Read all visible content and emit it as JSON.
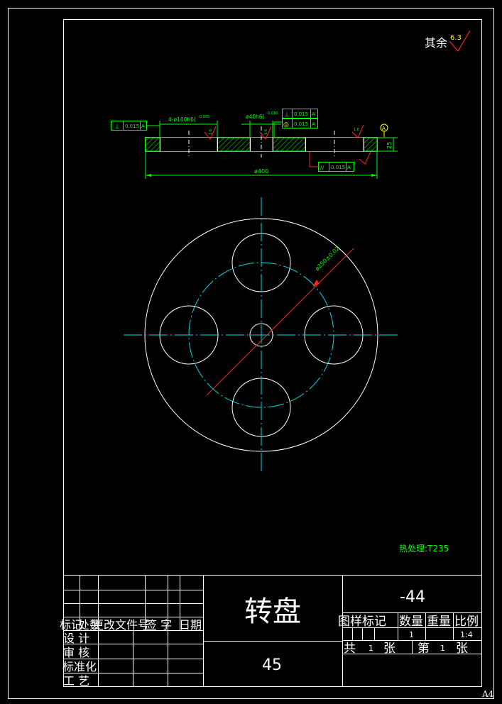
{
  "drawing": {
    "surface_note": "其余",
    "surface_value": "6.3",
    "heat_treatment": "热处理:T235",
    "sheet_size": "A4"
  },
  "section_view": {
    "dim_holes": "4-ø100h6(",
    "dim_holes_tol": "-0.035",
    "dim_center": "ø40h6(",
    "dim_center_tol": "-0.016",
    "dim_outer": "ø400",
    "dim_thickness": "25",
    "rough_a": "1.6",
    "rough_b": "1.6",
    "rough_c": "1.6",
    "datum_mark": "A",
    "fcf_left": {
      "symbol": "⊥",
      "value": "0.015",
      "datum": "A"
    },
    "fcf_top1": {
      "symbol": "⊥",
      "value": "0.015",
      "datum": "A"
    },
    "fcf_top2": {
      "symbol": "◎",
      "value": "0.015",
      "datum": "A"
    },
    "fcf_bottom": {
      "symbol": "//",
      "value": "0.015",
      "datum": "A"
    }
  },
  "plan_view": {
    "pcd_label": "ø250±0.02"
  },
  "title_block": {
    "part_name": "转盘",
    "material": "45",
    "drawing_no": "-44",
    "rev_headers": [
      "标记",
      "处数",
      "更改文件号",
      "签 字",
      "日期"
    ],
    "role_design": "设  计",
    "role_review": "审  核",
    "role_standard": "标准化",
    "role_process": "工  艺",
    "stage_header": "图样标记",
    "qty_header": "数量",
    "weight_header": "重量",
    "scale_header": "比例",
    "qty_value": "1",
    "scale_value": "1:4",
    "total_label": "共",
    "total_value": "1",
    "sheet_unit": "张",
    "sheet_label": "第",
    "sheet_value": "1",
    "sheet_unit2": "张"
  }
}
